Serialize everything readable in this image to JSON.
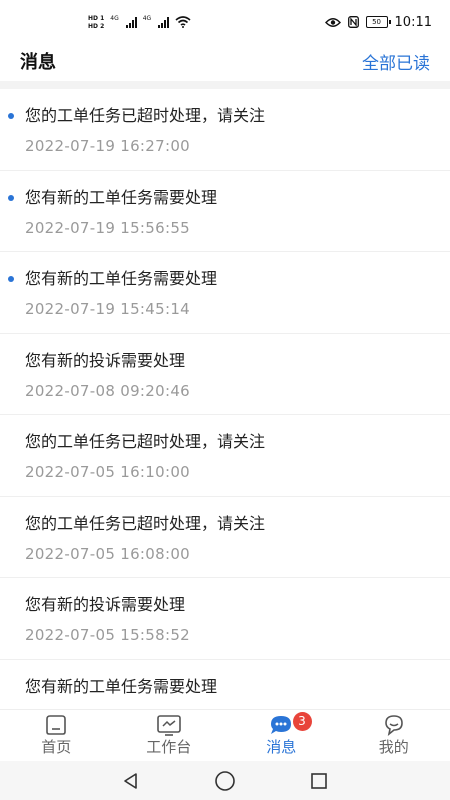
{
  "status_bar": {
    "sim1": "HD 1",
    "sim2": "HD 2",
    "net1": "4G",
    "net2": "4G",
    "battery": "50",
    "time": "10:11"
  },
  "header": {
    "title": "消息",
    "mark_all_read": "全部已读"
  },
  "colors": {
    "accent": "#2a74d6",
    "badge": "#e8443a",
    "time_text": "#9a9a9a"
  },
  "messages": [
    {
      "title": "您的工单任务已超时处理，请关注",
      "time": "2022-07-19 16:27:00",
      "unread": true
    },
    {
      "title": "您有新的工单任务需要处理",
      "time": "2022-07-19 15:56:55",
      "unread": true
    },
    {
      "title": "您有新的工单任务需要处理",
      "time": "2022-07-19 15:45:14",
      "unread": true
    },
    {
      "title": "您有新的投诉需要处理",
      "time": "2022-07-08 09:20:46",
      "unread": false
    },
    {
      "title": "您的工单任务已超时处理，请关注",
      "time": "2022-07-05 16:10:00",
      "unread": false
    },
    {
      "title": "您的工单任务已超时处理，请关注",
      "time": "2022-07-05 16:08:00",
      "unread": false
    },
    {
      "title": "您有新的投诉需要处理",
      "time": "2022-07-05 15:58:52",
      "unread": false
    },
    {
      "title": "您有新的工单任务需要处理",
      "time": "",
      "unread": false
    }
  ],
  "bottom_nav": {
    "items": [
      {
        "label": "首页",
        "icon": "home-icon",
        "active": false
      },
      {
        "label": "工作台",
        "icon": "workbench-icon",
        "active": false
      },
      {
        "label": "消息",
        "icon": "message-icon",
        "active": true,
        "badge": "3"
      },
      {
        "label": "我的",
        "icon": "profile-icon",
        "active": false
      }
    ]
  },
  "system_nav": {
    "icons": [
      "back-icon",
      "home-circle-icon",
      "recents-icon"
    ]
  }
}
